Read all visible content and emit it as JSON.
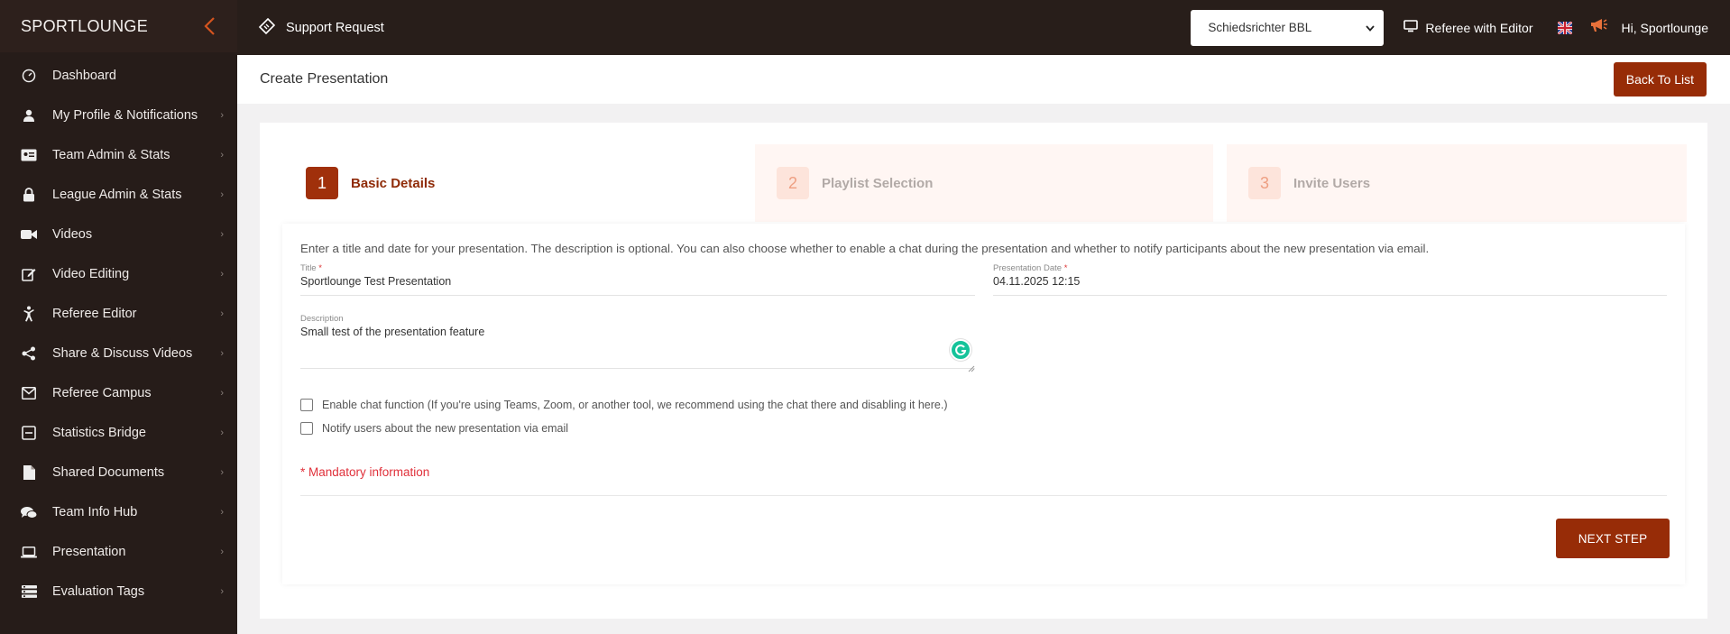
{
  "sidebar": {
    "brand": "SPORTLOUNGE",
    "items": [
      {
        "label": "Dashboard",
        "icon": "dashboard-gauge-icon",
        "has_submenu": false
      },
      {
        "label": "My Profile & Notifications",
        "icon": "user-icon",
        "has_submenu": true
      },
      {
        "label": "Team Admin & Stats",
        "icon": "id-card-icon",
        "has_submenu": true
      },
      {
        "label": "League Admin & Stats",
        "icon": "lock-icon",
        "has_submenu": true
      },
      {
        "label": "Videos",
        "icon": "video-camera-icon",
        "has_submenu": true
      },
      {
        "label": "Video Editing",
        "icon": "edit-icon",
        "has_submenu": true
      },
      {
        "label": "Referee Editor",
        "icon": "referee-icon",
        "has_submenu": true
      },
      {
        "label": "Share & Discuss Videos",
        "icon": "share-icon",
        "has_submenu": true
      },
      {
        "label": "Referee Campus",
        "icon": "envelope-open-icon",
        "has_submenu": true
      },
      {
        "label": "Statistics Bridge",
        "icon": "minus-square-icon",
        "has_submenu": true
      },
      {
        "label": "Shared Documents",
        "icon": "document-icon",
        "has_submenu": true
      },
      {
        "label": "Team Info Hub",
        "icon": "chat-bubbles-icon",
        "has_submenu": true
      },
      {
        "label": "Presentation",
        "icon": "laptop-icon",
        "has_submenu": true
      },
      {
        "label": "Evaluation Tags",
        "icon": "tags-list-icon",
        "has_submenu": true
      }
    ]
  },
  "topbar": {
    "support": "Support Request",
    "select_value": "Schiedsrichter BBL",
    "ref_editor": "Referee with Editor",
    "greeting": "Hi,  Sportlounge"
  },
  "header": {
    "title": "Create Presentation",
    "back": "Back To List"
  },
  "steps": [
    {
      "num": "1",
      "label": "Basic Details",
      "active": true
    },
    {
      "num": "2",
      "label": "Playlist Selection",
      "active": false
    },
    {
      "num": "3",
      "label": "Invite Users",
      "active": false
    }
  ],
  "form": {
    "intro": "Enter a title and date for your presentation. The description is optional. You can also choose whether to enable a chat during the presentation and whether to notify participants about the new presentation via email.",
    "title_label": "Title",
    "title_value": "Sportlounge Test Presentation",
    "date_label": "Presentation Date",
    "date_value": "04.11.2025 12:15",
    "desc_label": "Description",
    "desc_value": "Small test of the presentation feature",
    "required_mark": "*",
    "chat_label": "Enable chat function (If you're using Teams, Zoom, or another tool, we recommend using the chat there and disabling it here.)",
    "notify_label": "Notify users about the new presentation via email",
    "mandatory": "* Mandatory information",
    "next": "NEXT STEP"
  },
  "colors": {
    "brand_dark": "#261c19",
    "accent": "#972c07",
    "step_inactive_bg": "#fff6f3",
    "error": "#e0303a"
  }
}
